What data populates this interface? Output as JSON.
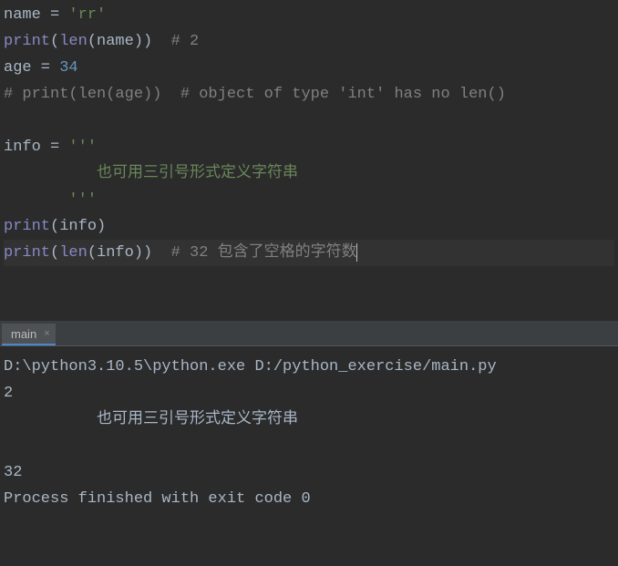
{
  "editor": {
    "line1": {
      "var": "name",
      "eq": " = ",
      "str": "'rr'"
    },
    "line2": {
      "fn": "print",
      "p1": "(",
      "builtin": "len",
      "p2": "(",
      "arg": "name",
      "p3": "))",
      "comment": "  # 2"
    },
    "line3": {
      "var": "age",
      "eq": " = ",
      "num": "34"
    },
    "line4": {
      "comment": "# print(len(age))  # object of type 'int' has no len()"
    },
    "line6": {
      "var": "info",
      "eq": " = ",
      "str": "'''"
    },
    "line7": {
      "str": "          也可用三引号形式定义字符串"
    },
    "line8": {
      "str": "       '''"
    },
    "line9": {
      "fn": "print",
      "p1": "(",
      "arg": "info",
      "p2": ")"
    },
    "line10": {
      "fn": "print",
      "p1": "(",
      "builtin": "len",
      "p2": "(",
      "arg": "info",
      "p3": "))",
      "comment": "  # 32 包含了空格的字符数"
    }
  },
  "tab": {
    "name": "main",
    "close": "×"
  },
  "console": {
    "lines": {
      "0": "D:\\python3.10.5\\python.exe D:/python_exercise/main.py",
      "1": "2",
      "2": "",
      "3": "          也可用三引号形式定义字符串",
      "4": "       ",
      "5": "32",
      "6": "",
      "7": "Process finished with exit code 0"
    }
  }
}
